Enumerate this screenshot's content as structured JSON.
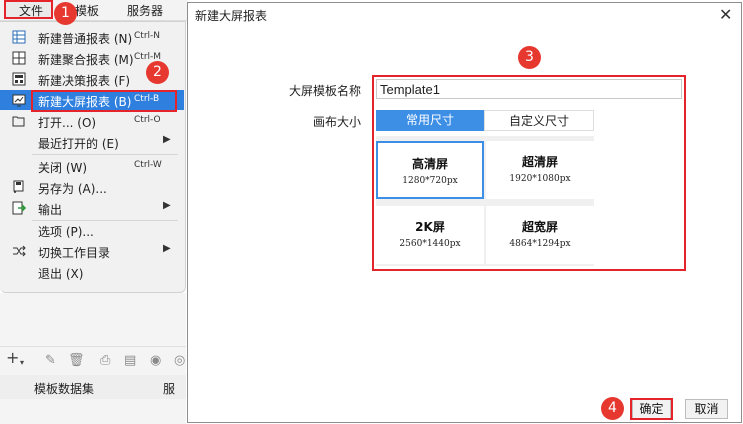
{
  "menubar": {
    "file": "文件",
    "template": "模板",
    "server": "服务器"
  },
  "file_menu": {
    "items": [
      {
        "label": "新建普通报表 (N)",
        "shortcut": "Ctrl-N",
        "icon": "grid-report-icon"
      },
      {
        "label": "新建聚合报表 (M)",
        "shortcut": "Ctrl-M",
        "icon": "aggregate-report-icon"
      },
      {
        "label": "新建决策报表 (F)",
        "shortcut": "",
        "icon": "dashboard-report-icon"
      },
      {
        "label": "新建大屏报表 (B)",
        "shortcut": "Ctrl-B",
        "icon": "big-screen-report-icon"
      },
      {
        "label": "打开... (O)",
        "shortcut": "Ctrl-O",
        "icon": "folder-icon"
      },
      {
        "label": "最近打开的 (E)",
        "shortcut": "",
        "icon": ""
      },
      {
        "label": "关闭 (W)",
        "shortcut": "Ctrl-W",
        "icon": ""
      },
      {
        "label": "另存为 (A)...",
        "shortcut": "",
        "icon": "save-as-icon"
      },
      {
        "label": "输出",
        "shortcut": "",
        "icon": "export-icon"
      },
      {
        "label": "选项 (P)...",
        "shortcut": "",
        "icon": ""
      },
      {
        "label": "切换工作目录",
        "shortcut": "",
        "icon": "switch-icon"
      },
      {
        "label": "退出 (X)",
        "shortcut": "",
        "icon": ""
      }
    ]
  },
  "left_panel": {
    "tab_dataset": "模板数据集",
    "tab_server": "服务"
  },
  "dialog": {
    "title": "新建大屏报表",
    "close": "✕",
    "name_label": "大屏模板名称",
    "name_value": "Template1",
    "canvas_label": "画布大小",
    "size_tabs": {
      "common": "常用尺寸",
      "custom": "自定义尺寸"
    },
    "sizes": [
      {
        "title": "高清屏",
        "dims": "1280*720px"
      },
      {
        "title": "超清屏",
        "dims": "1920*1080px"
      },
      {
        "title": "2K屏",
        "dims": "2560*1440px"
      },
      {
        "title": "超宽屏",
        "dims": "4864*1294px"
      }
    ],
    "ok": "确定",
    "cancel": "取消"
  },
  "badges": [
    "1",
    "2",
    "3",
    "4"
  ],
  "colors": {
    "accent": "#3d8fe6",
    "highlight": "#e5232b",
    "badge": "#e6382f",
    "menu_active": "#2f7fde"
  }
}
